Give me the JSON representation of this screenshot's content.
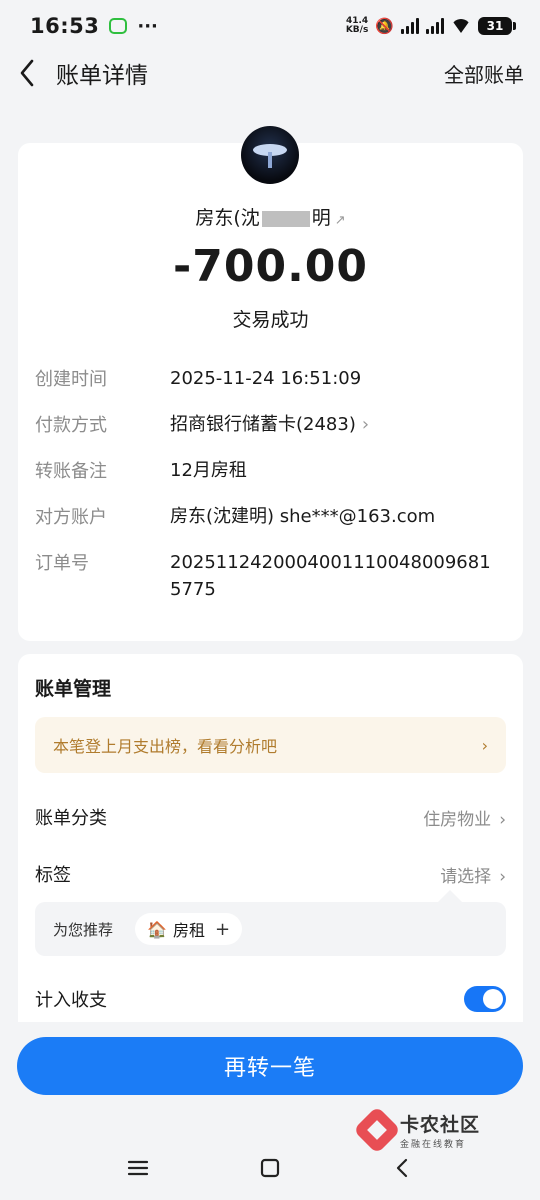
{
  "status_bar": {
    "time": "16:53",
    "dots": "···",
    "net_speed_value": "41.4",
    "net_speed_unit": "KB/s",
    "battery": "31"
  },
  "header": {
    "title": "账单详情",
    "all_bills": "全部账单"
  },
  "transaction": {
    "payee_prefix": "房东(沈",
    "payee_suffix": "明",
    "amount": "-700.00",
    "status": "交易成功"
  },
  "details": [
    {
      "label": "创建时间",
      "value": "2025-11-24 16:51:09"
    },
    {
      "label": "付款方式",
      "value": "招商银行储蓄卡(2483)"
    },
    {
      "label": "转账备注",
      "value": "12月房租"
    },
    {
      "label": "对方账户",
      "value": "房东(沈建明) she***@163.com"
    },
    {
      "label": "订单号",
      "value": "20251124200040011100480096815775"
    }
  ],
  "management": {
    "title": "账单管理",
    "promo": "本笔登上月支出榜，看看分析吧",
    "category_label": "账单分类",
    "category_value": "住房物业",
    "tag_label": "标签",
    "tag_value": "请选择",
    "recommend_label": "为您推荐",
    "recommend_chip": "房租",
    "income_label": "计入收支",
    "income_enabled": true
  },
  "actions": {
    "again": "再转一笔"
  },
  "watermark": {
    "main": "卡农社区",
    "sub": "金融在线教育"
  },
  "colors": {
    "accent": "#1b7cf6",
    "promo_text": "#b07c2e",
    "promo_bg": "#fbf5ea"
  }
}
